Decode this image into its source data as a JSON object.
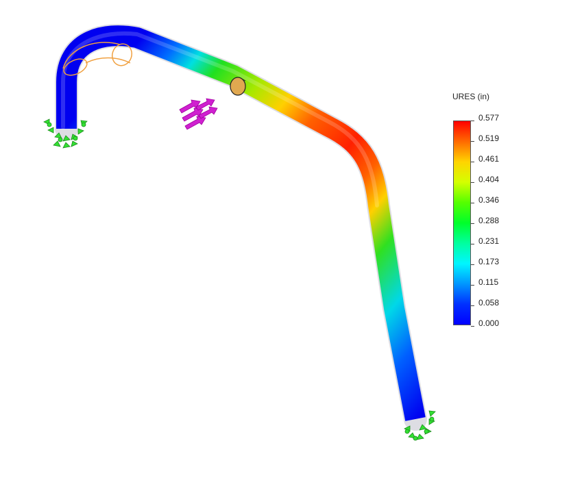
{
  "legend": {
    "title": "URES (in)",
    "labels": [
      "0.577",
      "0.519",
      "0.461",
      "0.404",
      "0.346",
      "0.288",
      "0.231",
      "0.173",
      "0.115",
      "0.058",
      "0.000"
    ],
    "gradient_colors": [
      "#ff0000",
      "#ff6a00",
      "#ffd400",
      "#d4ff00",
      "#55ff00",
      "#00ff2a",
      "#00ff9f",
      "#00f6ff",
      "#0096ff",
      "#0030ff",
      "#0000ff"
    ]
  },
  "icons": {
    "fixtures": "fixed-geometry-icon",
    "force": "force-arrows-icon",
    "sensor": "probe-sensor-icon"
  },
  "colors": {
    "fixture": "#33e033",
    "force": "#d020d0",
    "highlight": "#f0a040"
  }
}
